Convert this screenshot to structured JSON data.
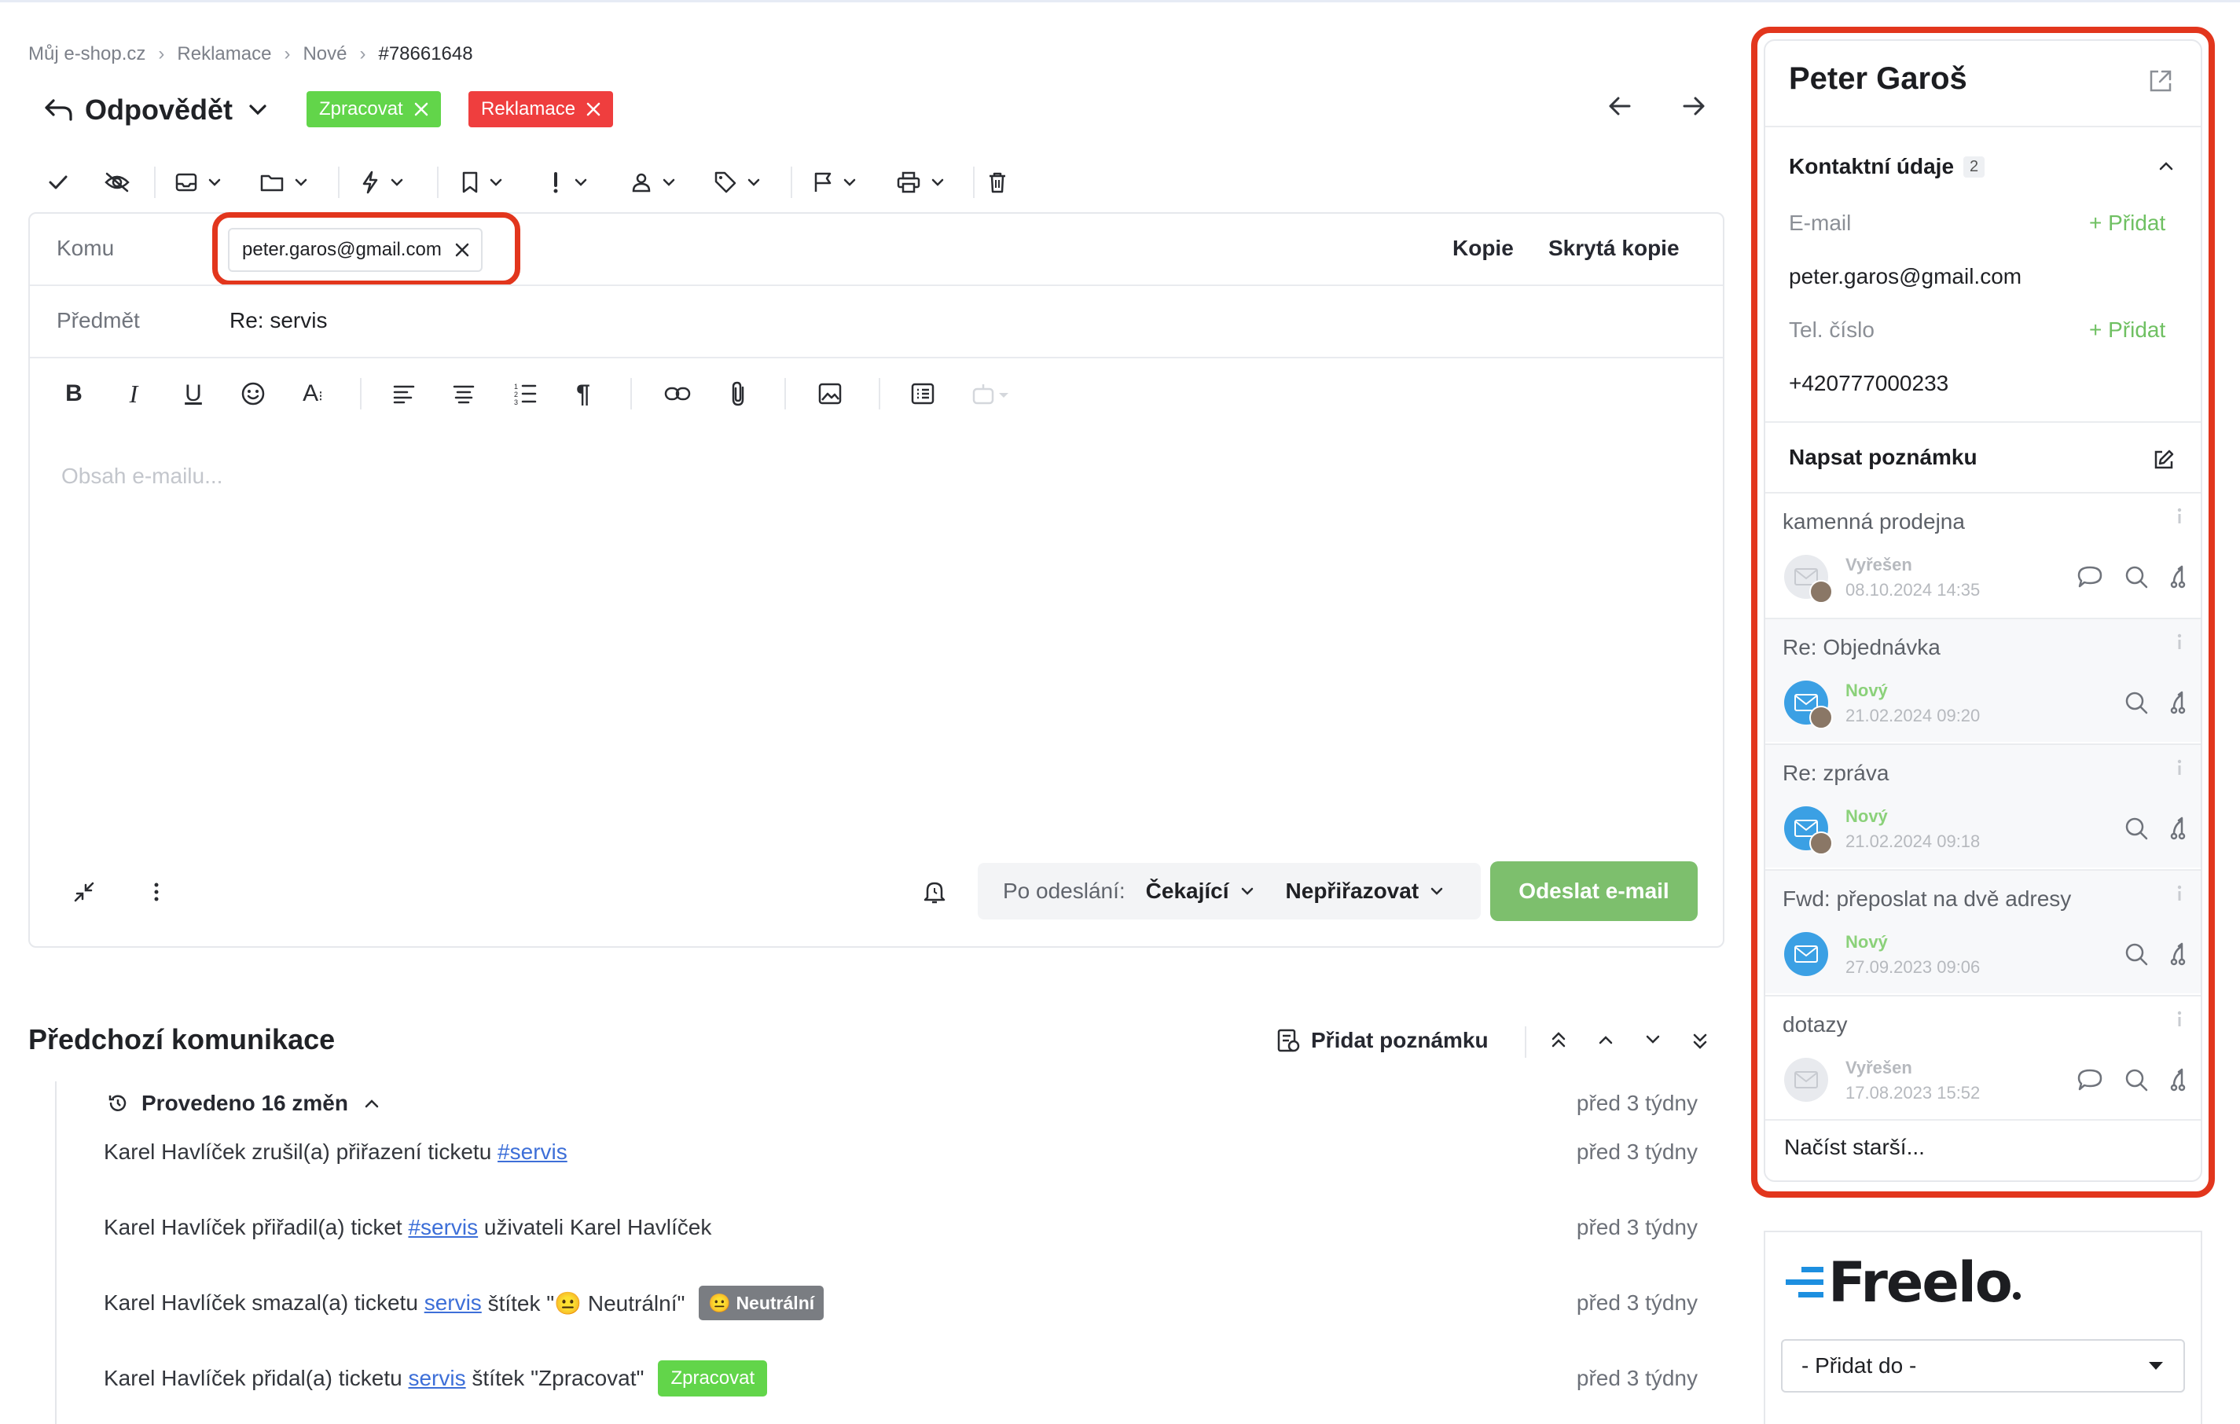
{
  "breadcrumb": {
    "items": [
      "Můj e-shop.cz",
      "Reklamace",
      "Nové",
      "#78661648"
    ],
    "separator": "›"
  },
  "header": {
    "reply_label": "Odpovědět",
    "tags": [
      {
        "label": "Zpracovat",
        "color": "#62d54a"
      },
      {
        "label": "Reklamace",
        "color": "#ef3e3e"
      }
    ]
  },
  "compose": {
    "to_label": "Komu",
    "to_email": "peter.garos@gmail.com",
    "cc_label": "Kopie",
    "bcc_label": "Skrytá kopie",
    "subject_label": "Předmět",
    "subject_value": "Re: servis",
    "body_placeholder": "Obsah e-mailu...",
    "after_send_label": "Po odeslání:",
    "after_send_status": "Čekající",
    "assign_value": "Nepřiřazovat",
    "send_label": "Odeslat e-mail"
  },
  "previous": {
    "title": "Předchozí komunikace",
    "add_note": "Přidat poznámku",
    "changes_header": "Provedeno 16 změn",
    "changes_time": "před 3 týdny",
    "entries": [
      {
        "before": "Karel Havlíček zrušil(a) přiřazení ticketu ",
        "link": "#servis",
        "after": "",
        "badge": "",
        "time": "před 3 týdny"
      },
      {
        "before": "Karel Havlíček přiřadil(a) ticket ",
        "link": "#servis",
        "after": " uživateli Karel Havlíček",
        "badge": "",
        "time": "před 3 týdny"
      },
      {
        "before": "Karel Havlíček smazal(a) ticketu ",
        "link": "servis",
        "after": " štítek \"😐 Neutrální\"",
        "badge": "😐 Neutrální",
        "time": "před 3 týdny"
      },
      {
        "before": "Karel Havlíček přidal(a) ticketu ",
        "link": "servis",
        "after": " štítek \"Zpracovat\"",
        "badge": "Zpracovat",
        "time": "před 3 týdny"
      }
    ]
  },
  "contact": {
    "name": "Peter Garoš",
    "section_title": "Kontaktní údaje",
    "section_count": "2",
    "email_label": "E-mail",
    "email_value": "peter.garos@gmail.com",
    "phone_label": "Tel. číslo",
    "phone_value": "+420777000233",
    "add_label": "+ Přidat",
    "note_label": "Napsat poznámku",
    "tickets": [
      {
        "subject": "kamenná prodejna",
        "status": "Vyřešen",
        "status_color": "#b6b9be",
        "date": "08.10.2024 14:35",
        "avatar": "grey",
        "comment_icon": true
      },
      {
        "subject": "Re: Objednávka",
        "status": "Nový",
        "status_color": "#8bd17a",
        "date": "21.02.2024 09:20",
        "avatar": "blue",
        "comment_icon": false
      },
      {
        "subject": "Re: zpráva",
        "status": "Nový",
        "status_color": "#8bd17a",
        "date": "21.02.2024 09:18",
        "avatar": "blue",
        "comment_icon": false
      },
      {
        "subject": "Fwd: přeposlat na dvě adresy",
        "status": "Nový",
        "status_color": "#8bd17a",
        "date": "27.09.2023 09:06",
        "avatar": "blue",
        "comment_icon": false
      },
      {
        "subject": "dotazy",
        "status": "Vyřešen",
        "status_color": "#b6b9be",
        "date": "17.08.2023 15:52",
        "avatar": "grey",
        "comment_icon": true
      }
    ],
    "load_older": "Načíst starší..."
  },
  "freelo": {
    "logo_text": "Freelo",
    "select_value": "- Přidat do -"
  }
}
